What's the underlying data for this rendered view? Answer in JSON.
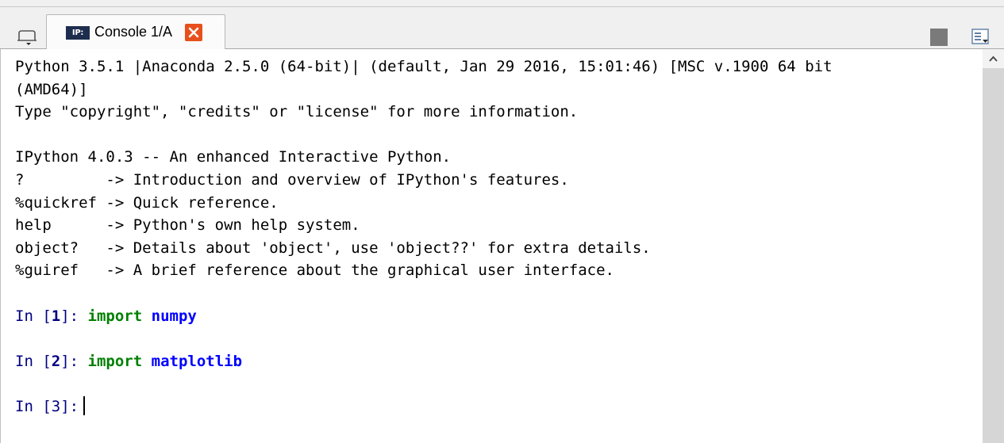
{
  "tab": {
    "ip_badge": "IP:",
    "label": "Console 1/A"
  },
  "console": {
    "banner": [
      "Python 3.5.1 |Anaconda 2.5.0 (64-bit)| (default, Jan 29 2016, 15:01:46) [MSC v.1900 64 bit",
      "(AMD64)]",
      "Type \"copyright\", \"credits\" or \"license\" for more information.",
      "",
      "IPython 4.0.3 -- An enhanced Interactive Python.",
      "?         -> Introduction and overview of IPython's features.",
      "%quickref -> Quick reference.",
      "help      -> Python's own help system.",
      "object?   -> Details about 'object', use 'object??' for extra details.",
      "%guiref   -> A brief reference about the graphical user interface.",
      ""
    ],
    "cells": [
      {
        "prompt_pre": "In [",
        "num": "1",
        "prompt_post": "]: ",
        "keyword": "import",
        "module": " numpy"
      },
      {
        "prompt_pre": "In [",
        "num": "2",
        "prompt_post": "]: ",
        "keyword": "import",
        "module": " matplotlib"
      }
    ],
    "current": {
      "prompt_pre": "In [",
      "num": "3",
      "prompt_post": "]:"
    }
  },
  "colors": {
    "prompt": "#000080",
    "keyword": "#008000",
    "module": "#0000ff",
    "close": "#e7501d"
  },
  "icons": [
    "browse-tabs-icon",
    "ipython-console-icon",
    "close-icon",
    "stop-icon",
    "options-icon",
    "scroll-up-icon"
  ]
}
